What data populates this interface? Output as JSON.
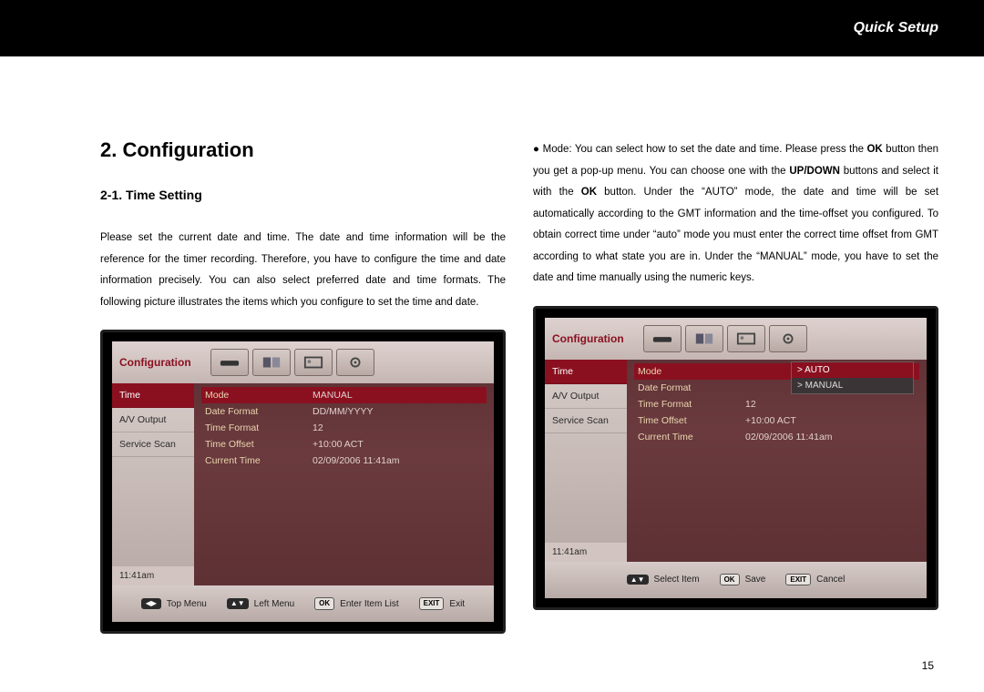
{
  "header": {
    "title": "Quick Setup"
  },
  "section": {
    "heading": "2. Configuration",
    "sub": "2-1. Time Setting"
  },
  "para_left": "Please set the current date and time. The date and time information will be the reference for the timer recording. Therefore, you have to configure the time and date information precisely. You can also select preferred date and time formats. The following picture illustrates the items which you configure to set the time and date.",
  "para_right_pre": "Mode: You can select how to set the date and time. Please press the ",
  "para_right_b1": "OK",
  "para_right_mid1": " button then you get a pop-up menu. You can choose one with the ",
  "para_right_b2": "UP/DOWN",
  "para_right_mid2": " buttons and select it with the ",
  "para_right_b3": "OK",
  "para_right_post": " button. Under the “AUTO” mode, the date and time will be set automatically according to the GMT information and the time-offset you configured. To obtain correct time under “auto” mode you must enter the correct time offset from GMT according to what state you are in. Under the “MANUAL” mode, you have to set the date and time manually using the numeric keys.",
  "pagenum": "15",
  "tv": {
    "title": "Configuration",
    "side": [
      "Time",
      "A/V Output",
      "Service Scan"
    ],
    "clock": "11:41am",
    "rows": [
      {
        "label": "Mode",
        "val": "MANUAL"
      },
      {
        "label": "Date Format",
        "val": "DD/MM/YYYY"
      },
      {
        "label": "Time Format",
        "val": "12"
      },
      {
        "label": "Time Offset",
        "val": "+10:00 ACT"
      },
      {
        "label": "Current Time",
        "val": "02/09/2006 11:41am"
      }
    ],
    "foot1": [
      {
        "key": "◀▶",
        "label": "Top Menu"
      },
      {
        "key": "▲▼",
        "label": "Left Menu"
      },
      {
        "key": "OK",
        "label": "Enter Item List",
        "boxed": true
      },
      {
        "key": "EXIT",
        "label": "Exit",
        "boxed": true
      }
    ]
  },
  "tv2": {
    "title": "Configuration",
    "side": [
      "Time",
      "A/V Output",
      "Service Scan"
    ],
    "clock": "11:41am",
    "rows": [
      {
        "label": "Mode",
        "val": ""
      },
      {
        "label": "Date Format",
        "val": ""
      },
      {
        "label": "Time Format",
        "val": "12"
      },
      {
        "label": "Time Offset",
        "val": "+10:00 ACT"
      },
      {
        "label": "Current Time",
        "val": "02/09/2006 11:41am"
      }
    ],
    "popup": [
      "> AUTO",
      "> MANUAL"
    ],
    "foot2": [
      {
        "key": "▲▼",
        "label": "Select Item"
      },
      {
        "key": "OK",
        "label": "Save",
        "boxed": true
      },
      {
        "key": "EXIT",
        "label": "Cancel",
        "boxed": true
      }
    ]
  }
}
